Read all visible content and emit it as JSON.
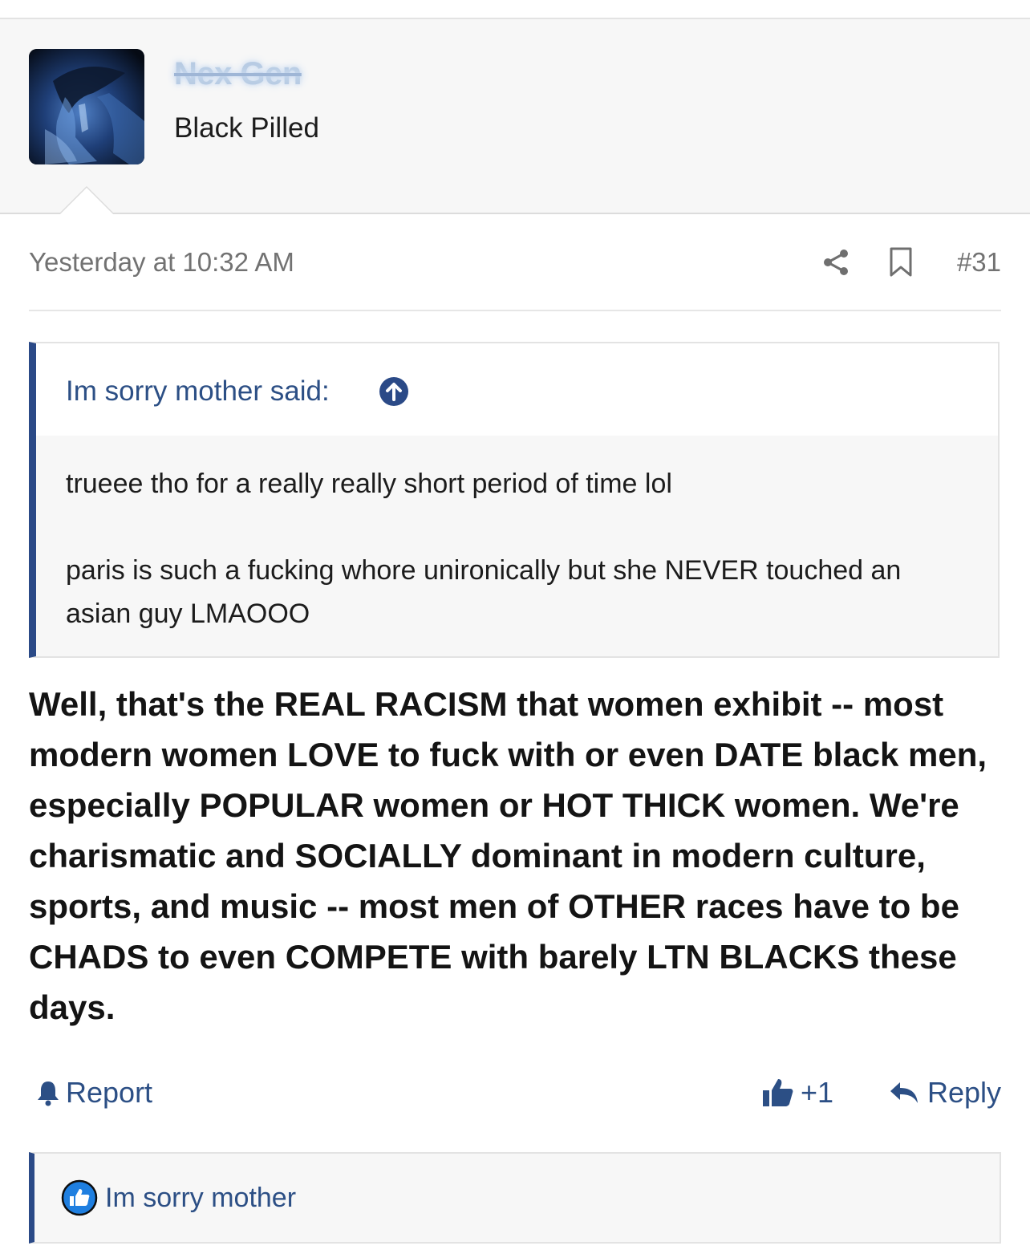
{
  "post": {
    "author": {
      "username": "Nex Gen",
      "title": "Black Pilled",
      "avatar": "alien-creature-avatar"
    },
    "timestamp": "Yesterday at 10:32 AM",
    "post_number": "#31",
    "quote": {
      "attribution": "Im sorry mother said:",
      "lines": [
        "trueee tho for a really really short period of time lol",
        "paris is such a fucking whore unironically but she NEVER touched an asian guy LMAOOO"
      ]
    },
    "message": "Well, that's the REAL RACISM that women exhibit -- most modern women LOVE to fuck with or even DATE black men, especially POPULAR women or HOT THICK women. We're charismatic and SOCIALLY dominant in modern culture, sports, and music -- most men of OTHER races have to be CHADS to even COMPETE with barely LTN BLACKS these days.",
    "actions": {
      "report": "Report",
      "like_count": "+1",
      "reply": "Reply"
    },
    "reactions": {
      "user": "Im sorry mother"
    }
  },
  "icons": {
    "share": "share-icon",
    "bookmark": "bookmark-icon",
    "quote_jump": "arrow-up-circle-icon",
    "report": "bell-icon",
    "like": "thumbs-up-icon",
    "reply": "reply-arrow-icon",
    "reaction": "like-reaction-icon"
  },
  "colors": {
    "link": "#2c4f85",
    "accent_bar": "#2b4a87",
    "username": "#b7cbe3",
    "muted": "#727272"
  }
}
